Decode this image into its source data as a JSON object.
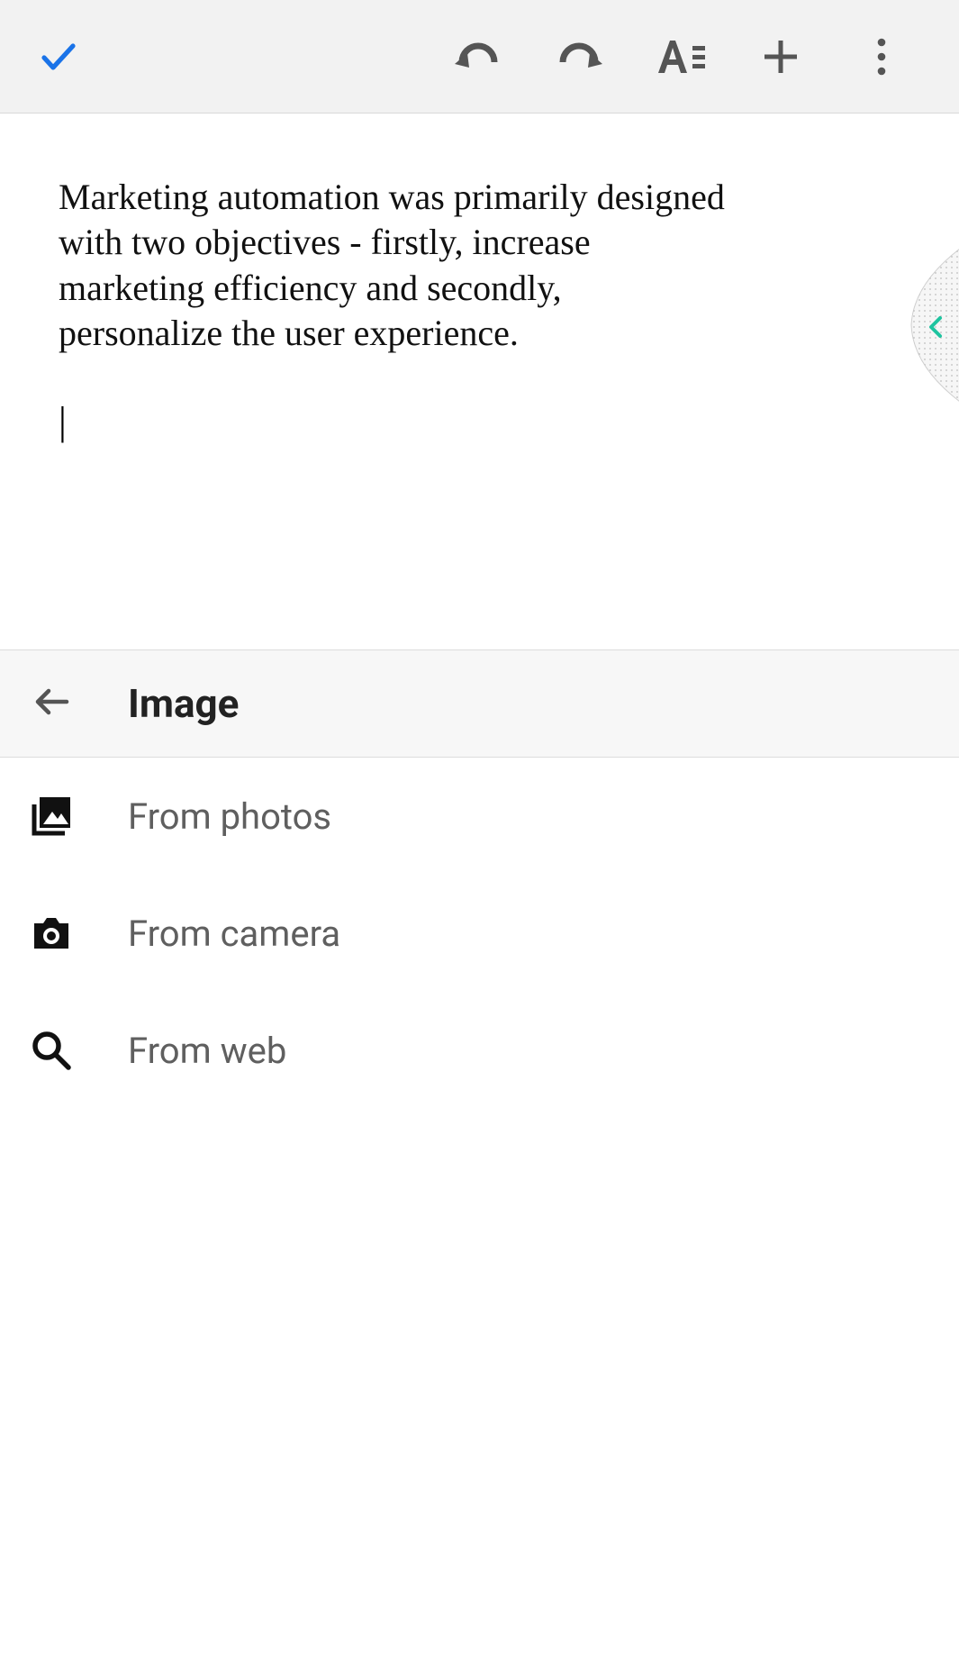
{
  "document": {
    "text": "Marketing automation was primarily designed with two objectives - firstly, increase marketing efficiency and secondly, personalize the user experience."
  },
  "panel": {
    "title": "Image",
    "items": [
      {
        "label": "From photos"
      },
      {
        "label": "From camera"
      },
      {
        "label": "From web"
      }
    ]
  }
}
